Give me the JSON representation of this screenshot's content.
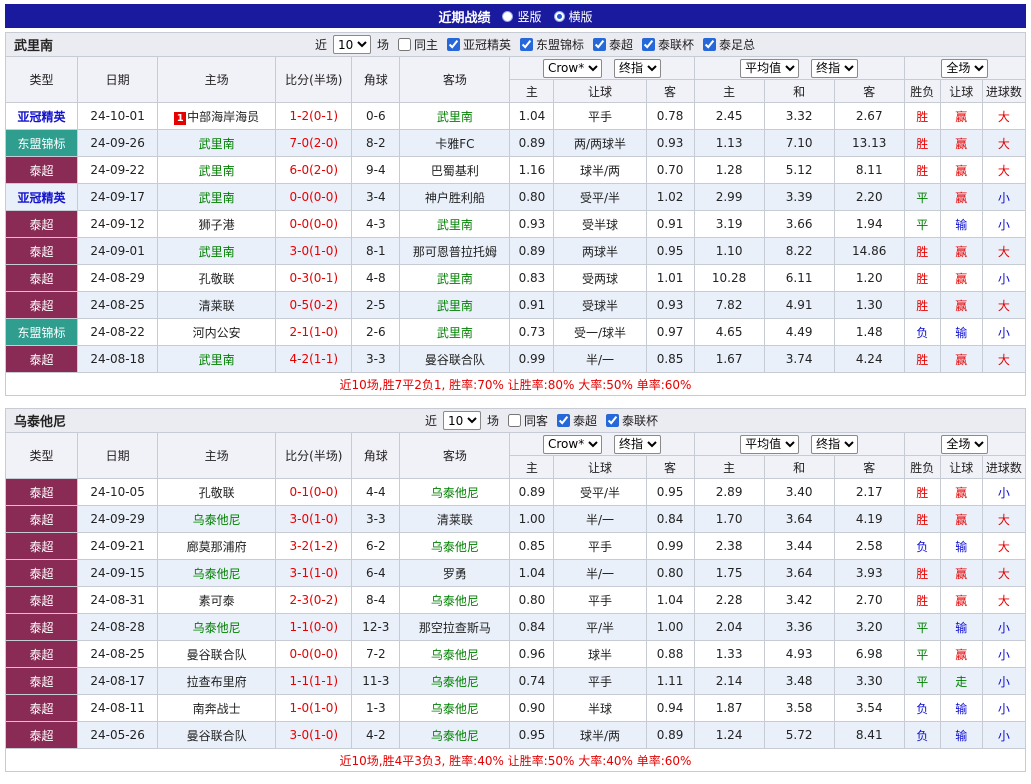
{
  "colors": {
    "title_bar_bg": "#1a1a9e",
    "win_red": "#e60000",
    "draw_green": "#008000",
    "loss_blue": "#0d0dd0",
    "team_name_green": "#008000",
    "thai_league_badge_bg": "#8a2b55",
    "asean_badge_bg": "#2f9e8f",
    "acl_text_blue": "#1414cc"
  },
  "title_bar": {
    "title": "近期战绩",
    "options": [
      {
        "label": "竖版",
        "selected": false
      },
      {
        "label": "横版",
        "selected": true
      }
    ]
  },
  "table_header": {
    "col_type": "类型",
    "col_date": "日期",
    "col_home": "主场",
    "col_score": "比分(半场)",
    "col_corner": "角球",
    "col_away": "客场",
    "sub": [
      "主",
      "让球",
      "客",
      "主",
      "和",
      "客",
      "胜负",
      "让球",
      "进球数"
    ]
  },
  "sections": [
    {
      "team": "武里南",
      "filter": {
        "near": "近",
        "count": "10",
        "games": "场",
        "same_label": "同主",
        "same_checked": false,
        "leagues": [
          {
            "label": "亚冠精英",
            "checked": true
          },
          {
            "label": "东盟锦标",
            "checked": true
          },
          {
            "label": "泰超",
            "checked": true
          },
          {
            "label": "泰联杯",
            "checked": true
          },
          {
            "label": "泰足总",
            "checked": true
          }
        ]
      },
      "selects": {
        "asia_source": "Crow*",
        "asia_time": "终指",
        "euro_source": "平均值",
        "euro_time": "终指",
        "scope": "全场"
      },
      "rows": [
        {
          "type": "亚冠精英",
          "date": "24-10-01",
          "home": "中部海岸海员",
          "home_badge": "1",
          "home_team": false,
          "score": "1-2(0-1)",
          "corners": "0-6",
          "away": "武里南",
          "away_team": true,
          "asia": [
            "1.04",
            "平手",
            "0.78"
          ],
          "euro": [
            "2.45",
            "3.32",
            "2.67"
          ],
          "results": [
            "胜",
            "赢",
            "大"
          ]
        },
        {
          "type": "东盟锦标",
          "date": "24-09-26",
          "home": "武里南",
          "home_team": true,
          "score": "7-0(2-0)",
          "corners": "8-2",
          "away": "卡雅FC",
          "away_team": false,
          "asia": [
            "0.89",
            "两/两球半",
            "0.93"
          ],
          "euro": [
            "1.13",
            "7.10",
            "13.13"
          ],
          "results": [
            "胜",
            "赢",
            "大"
          ]
        },
        {
          "type": "泰超",
          "date": "24-09-22",
          "home": "武里南",
          "home_team": true,
          "score": "6-0(2-0)",
          "corners": "9-4",
          "away": "巴蜀基利",
          "away_team": false,
          "asia": [
            "1.16",
            "球半/两",
            "0.70"
          ],
          "euro": [
            "1.28",
            "5.12",
            "8.11"
          ],
          "results": [
            "胜",
            "赢",
            "大"
          ]
        },
        {
          "type": "亚冠精英",
          "date": "24-09-17",
          "home": "武里南",
          "home_team": true,
          "score": "0-0(0-0)",
          "corners": "3-4",
          "away": "神户胜利船",
          "away_team": false,
          "asia": [
            "0.80",
            "受平/半",
            "1.02"
          ],
          "euro": [
            "2.99",
            "3.39",
            "2.20"
          ],
          "results": [
            "平",
            "赢",
            "小"
          ]
        },
        {
          "type": "泰超",
          "date": "24-09-12",
          "home": "狮子港",
          "home_team": false,
          "score": "0-0(0-0)",
          "corners": "4-3",
          "away": "武里南",
          "away_team": true,
          "asia": [
            "0.93",
            "受半球",
            "0.91"
          ],
          "euro": [
            "3.19",
            "3.66",
            "1.94"
          ],
          "results": [
            "平",
            "输",
            "小"
          ]
        },
        {
          "type": "泰超",
          "date": "24-09-01",
          "home": "武里南",
          "home_team": true,
          "score": "3-0(1-0)",
          "corners": "8-1",
          "away": "那可恩普拉托姆",
          "away_team": false,
          "asia": [
            "0.89",
            "两球半",
            "0.95"
          ],
          "euro": [
            "1.10",
            "8.22",
            "14.86"
          ],
          "results": [
            "胜",
            "赢",
            "大"
          ]
        },
        {
          "type": "泰超",
          "date": "24-08-29",
          "home": "孔敬联",
          "home_team": false,
          "score": "0-3(0-1)",
          "corners": "4-8",
          "away": "武里南",
          "away_team": true,
          "asia": [
            "0.83",
            "受两球",
            "1.01"
          ],
          "euro": [
            "10.28",
            "6.11",
            "1.20"
          ],
          "results": [
            "胜",
            "赢",
            "小"
          ]
        },
        {
          "type": "泰超",
          "date": "24-08-25",
          "home": "清莱联",
          "home_team": false,
          "score": "0-5(0-2)",
          "corners": "2-5",
          "away": "武里南",
          "away_team": true,
          "asia": [
            "0.91",
            "受球半",
            "0.93"
          ],
          "euro": [
            "7.82",
            "4.91",
            "1.30"
          ],
          "results": [
            "胜",
            "赢",
            "大"
          ]
        },
        {
          "type": "东盟锦标",
          "date": "24-08-22",
          "home": "河内公安",
          "home_team": false,
          "score": "2-1(1-0)",
          "corners": "2-6",
          "away": "武里南",
          "away_team": true,
          "asia": [
            "0.73",
            "受一/球半",
            "0.97"
          ],
          "euro": [
            "4.65",
            "4.49",
            "1.48"
          ],
          "results": [
            "负",
            "输",
            "小"
          ]
        },
        {
          "type": "泰超",
          "date": "24-08-18",
          "home": "武里南",
          "home_team": true,
          "score": "4-2(1-1)",
          "corners": "3-3",
          "away": "曼谷联合队",
          "away_team": false,
          "asia": [
            "0.99",
            "半/一",
            "0.85"
          ],
          "euro": [
            "1.67",
            "3.74",
            "4.24"
          ],
          "results": [
            "胜",
            "赢",
            "大"
          ]
        }
      ],
      "summary": "近10场,胜7平2负1, 胜率:70% 让胜率:80% 大率:50% 单率:60%"
    },
    {
      "team": "乌泰他尼",
      "filter": {
        "near": "近",
        "count": "10",
        "games": "场",
        "same_label": "同客",
        "same_checked": false,
        "leagues": [
          {
            "label": "泰超",
            "checked": true
          },
          {
            "label": "泰联杯",
            "checked": true
          }
        ]
      },
      "selects": {
        "asia_source": "Crow*",
        "asia_time": "终指",
        "euro_source": "平均值",
        "euro_time": "终指",
        "scope": "全场"
      },
      "rows": [
        {
          "type": "泰超",
          "date": "24-10-05",
          "home": "孔敬联",
          "home_team": false,
          "score": "0-1(0-0)",
          "corners": "4-4",
          "away": "乌泰他尼",
          "away_team": true,
          "asia": [
            "0.89",
            "受平/半",
            "0.95"
          ],
          "euro": [
            "2.89",
            "3.40",
            "2.17"
          ],
          "results": [
            "胜",
            "赢",
            "小"
          ]
        },
        {
          "type": "泰超",
          "date": "24-09-29",
          "home": "乌泰他尼",
          "home_team": true,
          "score": "3-0(1-0)",
          "corners": "3-3",
          "away": "清莱联",
          "away_team": false,
          "asia": [
            "1.00",
            "半/一",
            "0.84"
          ],
          "euro": [
            "1.70",
            "3.64",
            "4.19"
          ],
          "results": [
            "胜",
            "赢",
            "大"
          ]
        },
        {
          "type": "泰超",
          "date": "24-09-21",
          "home": "廊莫那浦府",
          "home_team": false,
          "score": "3-2(1-2)",
          "corners": "6-2",
          "away": "乌泰他尼",
          "away_team": true,
          "asia": [
            "0.85",
            "平手",
            "0.99"
          ],
          "euro": [
            "2.38",
            "3.44",
            "2.58"
          ],
          "results": [
            "负",
            "输",
            "大"
          ]
        },
        {
          "type": "泰超",
          "date": "24-09-15",
          "home": "乌泰他尼",
          "home_team": true,
          "score": "3-1(1-0)",
          "corners": "6-4",
          "away": "罗勇",
          "away_team": false,
          "asia": [
            "1.04",
            "半/一",
            "0.80"
          ],
          "euro": [
            "1.75",
            "3.64",
            "3.93"
          ],
          "results": [
            "胜",
            "赢",
            "大"
          ]
        },
        {
          "type": "泰超",
          "date": "24-08-31",
          "home": "素可泰",
          "home_team": false,
          "score": "2-3(0-2)",
          "corners": "8-4",
          "away": "乌泰他尼",
          "away_team": true,
          "asia": [
            "0.80",
            "平手",
            "1.04"
          ],
          "euro": [
            "2.28",
            "3.42",
            "2.70"
          ],
          "results": [
            "胜",
            "赢",
            "大"
          ]
        },
        {
          "type": "泰超",
          "date": "24-08-28",
          "home": "乌泰他尼",
          "home_team": true,
          "score": "1-1(0-0)",
          "corners": "12-3",
          "away": "那空拉查斯马",
          "away_team": false,
          "asia": [
            "0.84",
            "平/半",
            "1.00"
          ],
          "euro": [
            "2.04",
            "3.36",
            "3.20"
          ],
          "results": [
            "平",
            "输",
            "小"
          ]
        },
        {
          "type": "泰超",
          "date": "24-08-25",
          "home": "曼谷联合队",
          "home_team": false,
          "score": "0-0(0-0)",
          "corners": "7-2",
          "away": "乌泰他尼",
          "away_team": true,
          "asia": [
            "0.96",
            "球半",
            "0.88"
          ],
          "euro": [
            "1.33",
            "4.93",
            "6.98"
          ],
          "results": [
            "平",
            "赢",
            "小"
          ]
        },
        {
          "type": "泰超",
          "date": "24-08-17",
          "home": "拉查布里府",
          "home_team": false,
          "score": "1-1(1-1)",
          "corners": "11-3",
          "away": "乌泰他尼",
          "away_team": true,
          "asia": [
            "0.74",
            "平手",
            "1.11"
          ],
          "euro": [
            "2.14",
            "3.48",
            "3.30"
          ],
          "results": [
            "平",
            "走",
            "小"
          ]
        },
        {
          "type": "泰超",
          "date": "24-08-11",
          "home": "南奔战士",
          "home_team": false,
          "score": "1-0(1-0)",
          "corners": "1-3",
          "away": "乌泰他尼",
          "away_team": true,
          "asia": [
            "0.90",
            "半球",
            "0.94"
          ],
          "euro": [
            "1.87",
            "3.58",
            "3.54"
          ],
          "results": [
            "负",
            "输",
            "小"
          ]
        },
        {
          "type": "泰超",
          "date": "24-05-26",
          "home": "曼谷联合队",
          "home_team": false,
          "score": "3-0(1-0)",
          "corners": "4-2",
          "away": "乌泰他尼",
          "away_team": true,
          "asia": [
            "0.95",
            "球半/两",
            "0.89"
          ],
          "euro": [
            "1.24",
            "5.72",
            "8.41"
          ],
          "results": [
            "负",
            "输",
            "小"
          ]
        }
      ],
      "summary": "近10场,胜4平3负3, 胜率:40% 让胜率:50% 大率:40% 单率:60%"
    }
  ]
}
